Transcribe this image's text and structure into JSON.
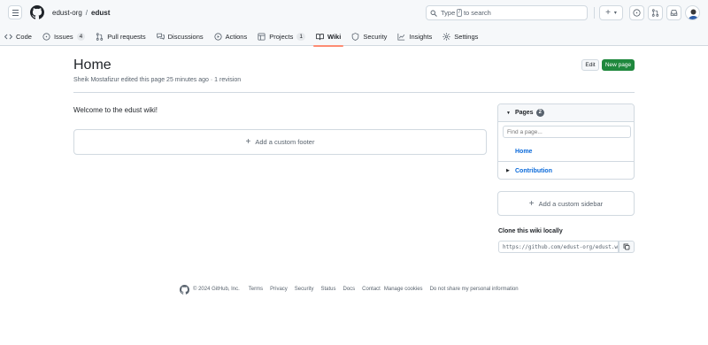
{
  "header": {
    "org": "edust-org",
    "separator": "/",
    "repo": "edust",
    "search": {
      "prefix": "Type",
      "key": "/",
      "suffix": "to search"
    },
    "plus": "+",
    "caret": "▾"
  },
  "tabs": [
    {
      "label": "Code",
      "icon": "code-icon"
    },
    {
      "label": "Issues",
      "icon": "issue-opened-icon",
      "count": "4"
    },
    {
      "label": "Pull requests",
      "icon": "git-pull-request-icon"
    },
    {
      "label": "Discussions",
      "icon": "comment-discussion-icon"
    },
    {
      "label": "Actions",
      "icon": "play-icon"
    },
    {
      "label": "Projects",
      "icon": "table-icon",
      "count": "1"
    },
    {
      "label": "Wiki",
      "icon": "book-icon",
      "active": true
    },
    {
      "label": "Security",
      "icon": "shield-icon"
    },
    {
      "label": "Insights",
      "icon": "graph-icon"
    },
    {
      "label": "Settings",
      "icon": "gear-icon"
    }
  ],
  "page": {
    "title": "Home",
    "meta": "Sheik Mostafizur edited this page 25 minutes ago · 1 revision",
    "edit_label": "Edit",
    "new_page_label": "New page",
    "body": "Welcome to the edust wiki!",
    "add_footer_label": "Add a custom footer"
  },
  "sidebar": {
    "pages_label": "Pages",
    "pages_count": "2",
    "find_placeholder": "Find a page...",
    "pages": [
      "Home",
      "Contribution"
    ],
    "add_sidebar_label": "Add a custom sidebar",
    "clone_label": "Clone this wiki locally",
    "clone_url": "https://github.com/edust-org/edust.wiki.git"
  },
  "footer": {
    "copyright": "© 2024 GitHub, Inc.",
    "links": [
      "Terms",
      "Privacy",
      "Security",
      "Status",
      "Docs",
      "Contact",
      "Manage cookies",
      "Do not share my personal information"
    ]
  },
  "colors": {
    "accent": "#fd8c73",
    "link": "#0969da",
    "primary_button": "#1f883d",
    "border": "#d1d9e0",
    "header_bg": "#f6f8fa"
  }
}
